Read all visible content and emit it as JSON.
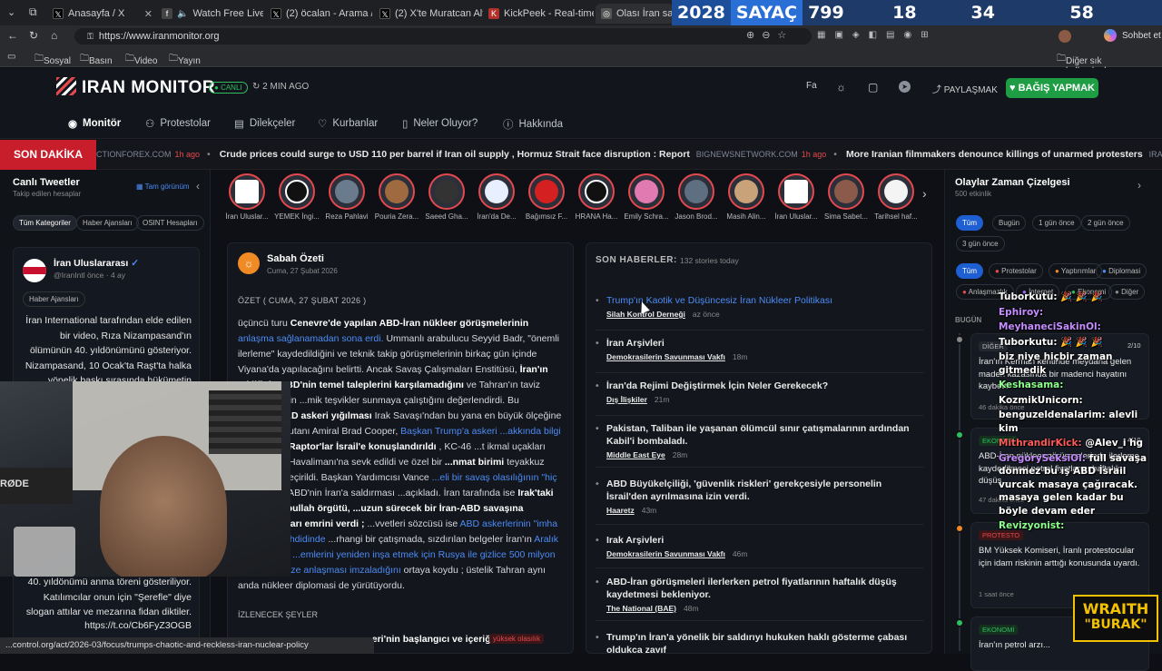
{
  "browser": {
    "tabs": [
      {
        "label": "Anasayfa / X",
        "icon": "x-icon"
      },
      {
        "label": "Watch Free Live W...",
        "icon": "film-icon"
      },
      {
        "label": "(2) öcalan - Arama / X",
        "icon": "x-icon"
      },
      {
        "label": "(2) X'te Muratcan Altun...",
        "icon": "x-icon"
      },
      {
        "label": "KickPeek - Real-time U...",
        "icon": "kick-icon"
      },
      {
        "label": "Olası İran saldırısı",
        "icon": "globe-icon"
      }
    ],
    "url": "https://www.iranmonitor.org",
    "profile_label": "Sohbet et",
    "bookmarks": [
      "Sosyal",
      "Basın",
      "Video",
      "Yayın"
    ],
    "bookmarks_other": "Diğer sık kullanılanlar",
    "status_url": "...control.org/act/2026-03/focus/trumps-chaotic-and-reckless-iran-nuclear-policy"
  },
  "counter": {
    "year": "2028",
    "label": "SAYAÇ",
    "days": "799 Gün",
    "hours": "18 Saat",
    "minutes": "34 Dakika",
    "seconds": "58 Saniye"
  },
  "header": {
    "logo": "IRAN MONITOR",
    "live_badge": "CANLI",
    "updated": "2 MIN AGO",
    "lang": "Fa",
    "share": "PAYLAŞMAK",
    "donate": "BAĞIŞ YAPMAK"
  },
  "nav": [
    {
      "label": "Monitör",
      "icon": "eye-icon"
    },
    {
      "label": "Protestolar",
      "icon": "people-icon"
    },
    {
      "label": "Dilekçeler",
      "icon": "document-icon"
    },
    {
      "label": "Kurbanlar",
      "icon": "heart-icon"
    },
    {
      "label": "Neler Oluyor?",
      "icon": "book-icon"
    },
    {
      "label": "Hakkında",
      "icon": "info-icon"
    }
  ],
  "ticker": {
    "label": "SON DAKİKA",
    "items": [
      {
        "source": "CTIONFOREX.COM",
        "ago": "1h ago",
        "text": "Crude prices could surge to USD 110 per barrel if Iran oil supply , Hormuz Strait face disruption : Report"
      },
      {
        "source": "BIGNEWSNETWORK.COM",
        "ago": "1h ago",
        "text": "More Iranian filmmakers denounce killings of unarmed protesters"
      },
      {
        "source": "IRAN INTERNATIONAL (EN)",
        "ago": "",
        "text": ""
      }
    ]
  },
  "left_panel": {
    "title": "Canlı Tweetler",
    "subtitle": "Takip edilen hesaplar",
    "full_view": "Tam görünüm",
    "filters": [
      "Tüm Kategoriler",
      "Haber Ajansları",
      "OSINT Hesapları"
    ],
    "tweet": {
      "name": "İran Uluslararası",
      "handle": "@IranIntl önce · 4 ay",
      "tag": "Haber Ajansları",
      "body_top": "İran International tarafından elde edilen bir video, Rıza Nizampasand'ın ölümünün 40. yıldönümünü gösteriyor. Nizampasand, 10 Ocak'ta Raşt'ta halka yönelik baskı sırasında hükümetin açtığı",
      "body_bottom": "40. yıldönümü anma töreni gösteriliyor. Katılımcılar onun için \"Şerefle\" diye slogan attılar ve mezarına fidan diktiler.",
      "link": "https://t.co/Cb6FyZ3OGB"
    }
  },
  "stories": [
    "İran Uluslar...",
    "YEMEK İngi...",
    "Reza Pahlavi",
    "Pouria Zera...",
    "Saeed Gha...",
    "İran'da De...",
    "Bağımsız F...",
    "HRANA Ha...",
    "Emily Schra...",
    "Jason Brod...",
    "Masih Alin...",
    "İran Uluslar...",
    "Sima Sabet...",
    "Tarihsel haf..."
  ],
  "summary": {
    "title": "Sabah Özeti",
    "date": "Cuma, 27 Şubat 2026",
    "section": "ÖZET ( CUMA, 27 ŞUBAT 2026 )",
    "p1": "üçüncü turu ",
    "p1b": "Cenevre'de yapılan ABD-İran nükleer görüşmelerinin",
    "p1link": " anlaşma sağlanamadan sona erdi.",
    "p2": " Ummanlı arabulucu Seyyid Badr, \"önemli ilerleme\" kaydedildiğini ve teknik takip görüşmelerinin birkaç gün içinde Viyana'da yapılacağını belirtti. Ancak Savaş Çalışmaları Enstitüsü, ",
    "p2b": "İran'ın teklifinin ABD'nin temel taleplerini karşılamadığını",
    "p3": " ve Tahran'ın taviz koparmak için ...mik teşvikler sunmaya çalıştığını değerlendirdi. Bu diplomatik ",
    "p3b": "...D askeri yığılması",
    "p4": " Irak Savaşı'ndan bu yana en büyük ölçeğine ...COM komutanı Amiral Brad Cooper, ",
    "p4link": "Başkan Trump'a askeri ...akkında bilgi verdi",
    "p5b": " , F-22 Raptor'lar İsrail'e konuşlandırıldı",
    "p5": " , KC-46 ...t ikmal uçakları Ben Gurion Havalimanı'na sevk edildi ve özel bir ",
    "p5c": "...nmat birimi",
    "p6": " teyakkuz durumuna geçirildi. Başkan Yardımcısı Vance ",
    "p6link": "...eli bir savaş olasılığının \"hiç olmadığını\"",
    "p7": " ABD'nin İran'a saldırması ...açıkladı. İran tarafında ise ",
    "p7b": "Irak'taki Kataeb Hizbullah örgütü, ...uzun sürecek bir İran-ABD savaşına hazırlanmaları emrini verdi ;",
    "p8": " ...vvetleri sözcüsü ise ",
    "p8link": "ABD askerlerinin \"imha edileceği\" tehdidinde",
    "p9": " ...rhangi bir çatışmada, sızdırılan belgeler İran'ın ",
    "p9link": "Aralık ayında hava ...emlerini yeniden inşa etmek için Rusya ile gizlice 500 milyon ...avrolar ...aze anlaşması imzaladığını",
    "p10": " ortaya koydu ; üstelik Tahran aynı anda nükleer diplomasi de yürütüyordu.",
    "watch_label": "İZLENECEK ŞEYLER",
    "watch_item": "...eri'nin başlangıcı ve içeriği",
    "watch_badge": "yüksek olasılık"
  },
  "news": {
    "title": "SON HABERLER:",
    "count": "132 stories today",
    "items": [
      {
        "title": "Trump'ın Kaotik ve Düşüncesiz İran Nükleer Politikası",
        "source": "Silah Kontrol Derneği",
        "ago": "az önce",
        "hover": true
      },
      {
        "title": "İran Arşivleri",
        "source": "Demokrasilerin Savunması Vakfı",
        "ago": "18m"
      },
      {
        "title": "İran'da Rejimi Değiştirmek İçin Neler Gerekecek?",
        "source": "Dış İlişkiler",
        "ago": "21m"
      },
      {
        "title": "Pakistan, Taliban ile yaşanan ölümcül sınır çatışmalarının ardından Kabil'i bombaladı.",
        "source": "Middle East Eye",
        "ago": "28m"
      },
      {
        "title": "ABD Büyükelçiliği, 'güvenlik riskleri' gerekçesiyle personelin İsrail'den ayrılmasına izin verdi.",
        "source": "Haaretz",
        "ago": "43m"
      },
      {
        "title": "Irak Arşivleri",
        "source": "Demokrasilerin Savunması Vakfı",
        "ago": "46m"
      },
      {
        "title": "ABD-İran görüşmeleri ilerlerken petrol fiyatlarının haftalık düşüş kaydetmesi bekleniyor.",
        "source": "The National (BAE)",
        "ago": "48m"
      },
      {
        "title": "Trump'ın İran'a yönelik bir saldırıyı hukuken haklı gösterme çabası oldukça zayıf",
        "source": "",
        "ago": ""
      }
    ]
  },
  "timeline": {
    "title": "Olaylar Zaman Çizelgesi",
    "count": "500 etkinlik",
    "time_filters": [
      "Tüm",
      "Bugün",
      "1 gün önce",
      "2 gün önce",
      "3 gün önce"
    ],
    "cat_filters": [
      "Tüm",
      "Protestolar",
      "Yaptırımlar",
      "Diplomasi",
      "Anlaşmazlık",
      "İnternet",
      "Ekonomi",
      "Diğer"
    ],
    "day_label": "BUGÜN",
    "events": [
      {
        "tag": "DİĞER",
        "title": "İran'ın Kerman kentinde meydana gelen maden kazasında bir madenci hayatını kaybetti.",
        "meta": "46 dakika önce",
        "page": "2/10"
      },
      {
        "tag": "EKONOMİ",
        "title": "ABD-İran nükleer görüşmelerinde ilerleme kaydedilmesi petrol fiyatlarını haftalık düşüş...",
        "meta": "47 dakika önce",
        "page": "4/10"
      },
      {
        "tag": "PROTESTO",
        "title": "BM Yüksek Komiseri, İranlı protestocular için idam riskinin arttığı konusunda uyardı.",
        "meta": "1 saat önce",
        "page": ""
      },
      {
        "tag": "EKONOMİ",
        "title": "İran'ın petrol arzı...",
        "meta": "",
        "page": ""
      }
    ]
  },
  "chat": [
    {
      "user": "Tuborkutu:",
      "msg": "🎉 🎉 🎉",
      "color": "#ffffff"
    },
    {
      "user": "Ephiroy:",
      "msg": "",
      "color": "#c58cff"
    },
    {
      "user": "MeyhaneciSakinOl:",
      "msg": "",
      "color": "#c58cff"
    },
    {
      "user": "Tuborkutu:",
      "msg": "🎉 🎉 🎉",
      "color": "#ffffff"
    },
    {
      "user": "",
      "msg": "biz niye hiçbir zaman gitmedik",
      "color": "#ffffff"
    },
    {
      "user": "Keshasama:",
      "msg": "",
      "color": "#8cff8c"
    },
    {
      "user": "KozmikUnicorn:",
      "msg": "",
      "color": "#ffffff"
    },
    {
      "user": "benguzeldenalarim:",
      "msg": "alevli kim",
      "color": "#ffffff"
    },
    {
      "user": "MithrandirKick:",
      "msg": "@Alev_i hg",
      "color": "#ff5a5a"
    },
    {
      "user": "...:",
      "msg": "",
      "color": "#ff5a5a"
    },
    {
      "user": "GregorySeksiOl:",
      "msg": "full savaşa dönmez bu iş ABD İsrail vurcak masaya çağıracak. masaya gelen kadar bu böyle devam eder",
      "color": "#c58cff"
    },
    {
      "user": "Revizyonist:",
      "msg": "",
      "color": "#8cff8c"
    }
  ],
  "overlay": {
    "line1": "WRAITH",
    "line2": "\"BURAK\""
  },
  "colors": {
    "accent": "#e5484d",
    "link": "#4c8cf5",
    "donate": "#1f9d45",
    "breaking": "#c81e2b"
  }
}
